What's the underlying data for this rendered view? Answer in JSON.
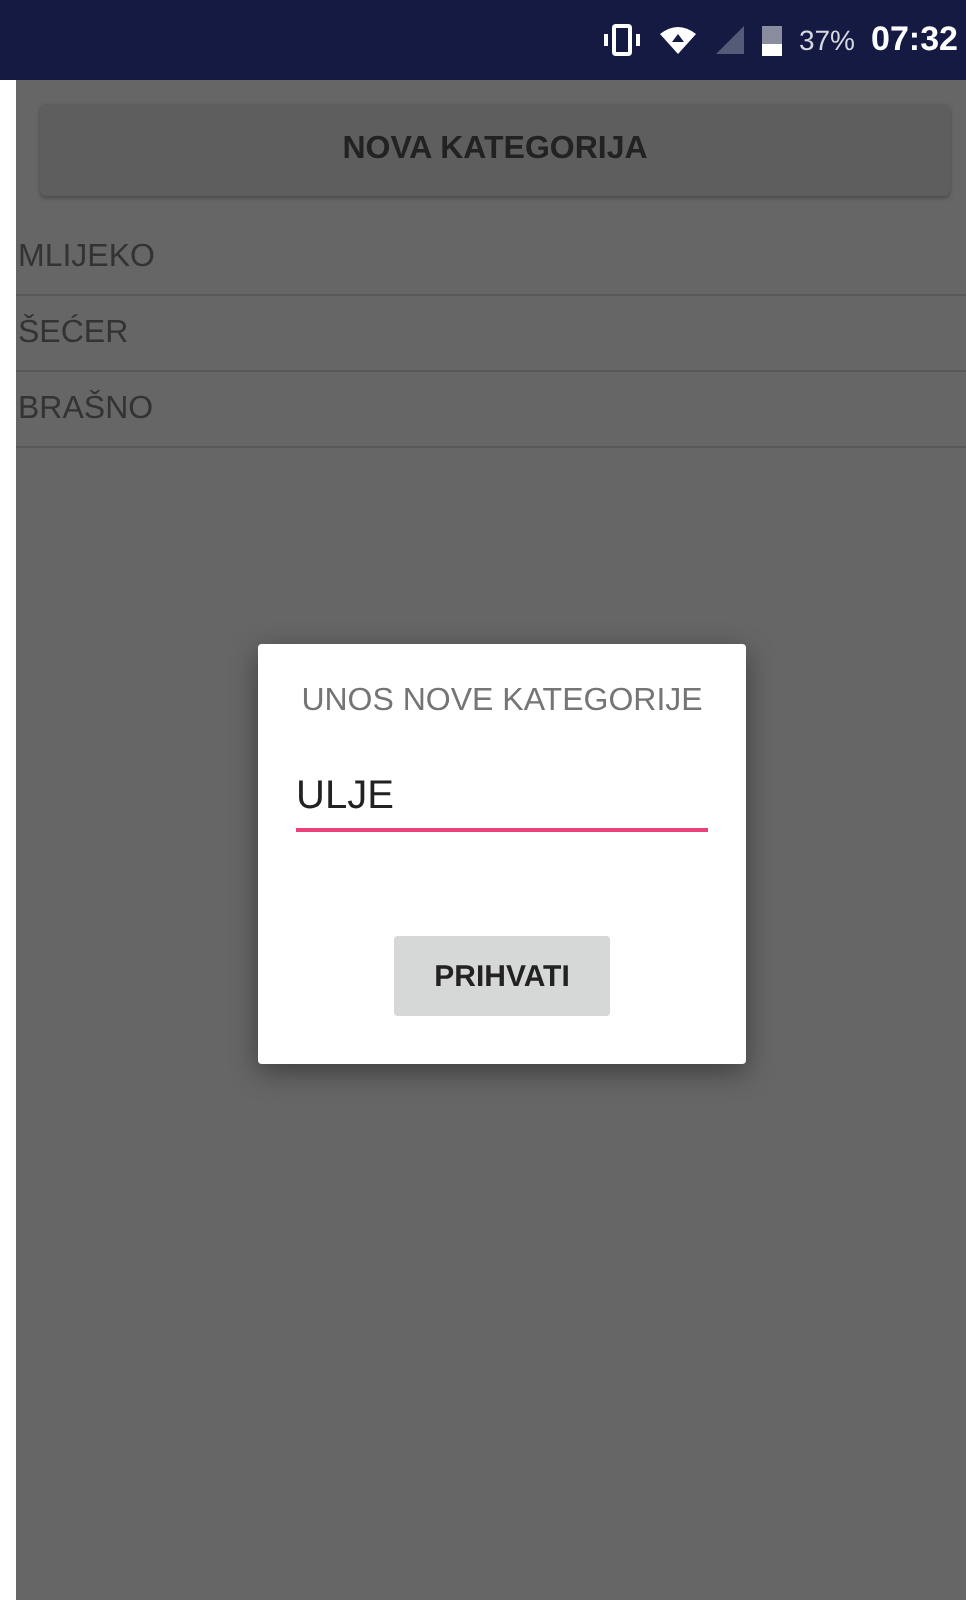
{
  "status_bar": {
    "battery": "37%",
    "time": "07:32"
  },
  "new_category_button": {
    "label": "NOVA KATEGORIJA"
  },
  "categories": [
    {
      "name": "MLIJEKO"
    },
    {
      "name": "ŠEĆER"
    },
    {
      "name": "BRAŠNO"
    }
  ],
  "dialog": {
    "title": "UNOS NOVE KATEGORIJE",
    "value": "ULJE",
    "button": "PRIHVATI"
  }
}
